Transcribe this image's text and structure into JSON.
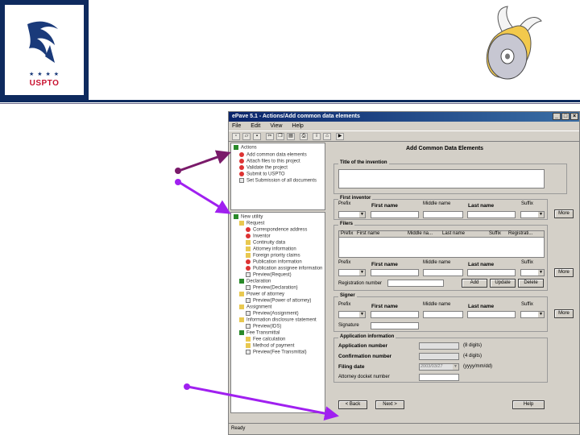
{
  "logo": {
    "text": "USPTO",
    "stars": "★ ★ ★ ★"
  },
  "window": {
    "title": "ePave 5.1 - Actions/Add common data elements",
    "menu": [
      "File",
      "Edit",
      "View",
      "Help"
    ],
    "buttons": {
      "minimize": "_",
      "maximize": "□",
      "close": "×"
    }
  },
  "tree_actions": {
    "root": "Actions",
    "items": [
      "Add common data elements",
      "Attach files to this project",
      "Validate the project",
      "Submit to USPTO",
      "Set Submission of all documents"
    ]
  },
  "tree_documents": {
    "root": "New utility",
    "items": [
      "Request",
      "Correspondence address",
      "Inventor",
      "Continuity data",
      "Attorney information",
      "Foreign priority claims",
      "Publication information",
      "Publication assignee information",
      "Preview(Request)",
      "Declaration",
      "Preview(Declaration)",
      "Power of attorney",
      "Preview(Power of attorney)",
      "Assignment",
      "Preview(Assignment)",
      "Information disclosure statement",
      "Preview(IDS)",
      "Fee Transmittal",
      "Fee calculation",
      "Method of payment",
      "Preview(Fee Transmittal)"
    ]
  },
  "panel": {
    "heading": "Add Common Data Elements",
    "title_group": "Title of the invention",
    "first_inventor": {
      "group": "First inventor",
      "prefix": "Prefix",
      "first": "First name",
      "middle": "Middle name",
      "last": "Last name",
      "suffix": "Suffix",
      "more": "More"
    },
    "filers": {
      "group": "Filers",
      "columns": [
        "Prefix",
        "First name",
        "Middle na...",
        "Last name",
        "Suffix",
        "Registrati..."
      ],
      "prefix": "Prefix",
      "first": "First name",
      "middle": "Middle name",
      "last": "Last name",
      "suffix": "Suffix",
      "more": "More",
      "reg_label": "Registration number",
      "add": "Add",
      "update": "Update",
      "delete": "Delete"
    },
    "signer": {
      "group": "Signer",
      "prefix": "Prefix",
      "first": "First name",
      "middle": "Middle name",
      "last": "Last name",
      "suffix": "Suffix",
      "more": "More",
      "sig_label": "Signature"
    },
    "appinfo": {
      "group": "Application information",
      "app_number": "Application number",
      "app_digits": "(8 digits)",
      "conf_number": "Confirmation number",
      "conf_digits": "(4 digits)",
      "filing_date": "Filing date",
      "filing_value": "2003/03/27",
      "date_fmt": "(yyyy/mm/dd)",
      "docket": "Attorney docket number"
    },
    "nav": {
      "cancel": "< Back",
      "next": "Next >",
      "help": "Help"
    }
  },
  "status": "Ready"
}
